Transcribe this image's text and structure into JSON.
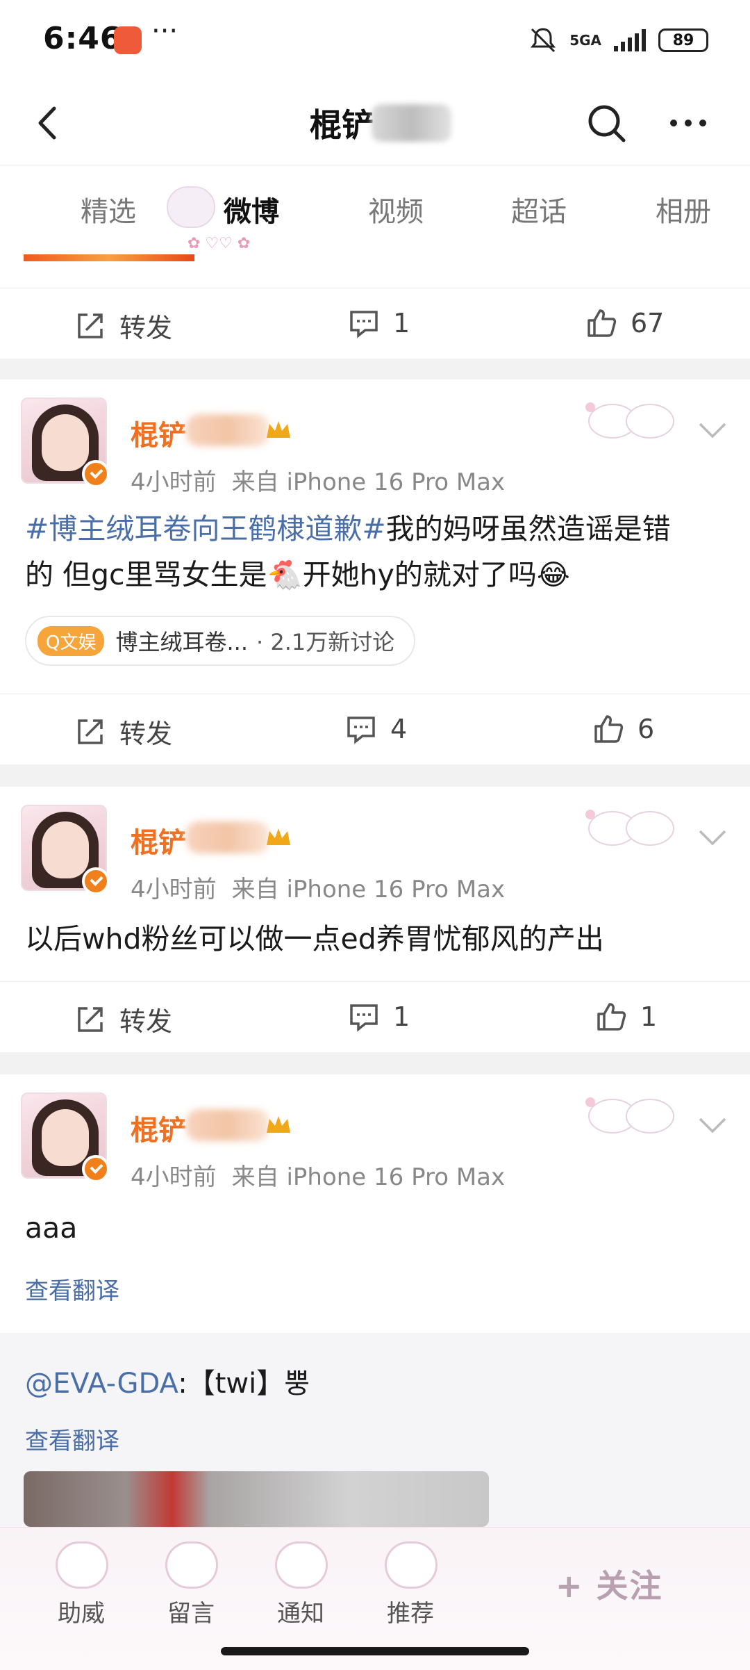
{
  "status_bar": {
    "time": "6:46",
    "dots": "···",
    "network": "5GA",
    "battery": "89"
  },
  "nav": {
    "title": "棍铲"
  },
  "tabs": [
    {
      "label": "精选",
      "active": false
    },
    {
      "label": "微博",
      "active": true
    },
    {
      "label": "视频",
      "active": false
    },
    {
      "label": "超话",
      "active": false
    },
    {
      "label": "相册",
      "active": false
    }
  ],
  "prev_post_actions": {
    "repost_label": "转发",
    "comment_count": "1",
    "like_count": "67"
  },
  "posts": [
    {
      "username": "棍铲",
      "time": "4小时前",
      "source": "来自 iPhone 16 Pro Max",
      "hashtag": "#博主绒耳卷向王鹤棣道歉#",
      "text_line1": "我的妈呀虽然造谣是错",
      "text_line2": "的 但gc里骂女生是🐔开她hy的就对了吗😂",
      "topic_badge": "Q文娱",
      "topic_name": "博主绒耳卷...",
      "topic_stats": "· 2.1万新讨论",
      "repost_label": "转发",
      "comment_count": "4",
      "like_count": "6"
    },
    {
      "username": "棍铲",
      "time": "4小时前",
      "source": "来自 iPhone 16 Pro Max",
      "text": "以后whd粉丝可以做一点ed养胃忧郁风的产出",
      "repost_label": "转发",
      "comment_count": "1",
      "like_count": "1"
    },
    {
      "username": "棍铲",
      "time": "4小时前",
      "source": "来自 iPhone 16 Pro Max",
      "text": "aaa",
      "translate": "查看翻译",
      "repost_mention": "@EVA-GDA",
      "repost_text": ":【twi】뿡",
      "repost_translate": "查看翻译"
    }
  ],
  "bottom_bar": {
    "items": [
      "助威",
      "留言",
      "通知",
      "推荐"
    ],
    "follow": "+ 关注"
  }
}
